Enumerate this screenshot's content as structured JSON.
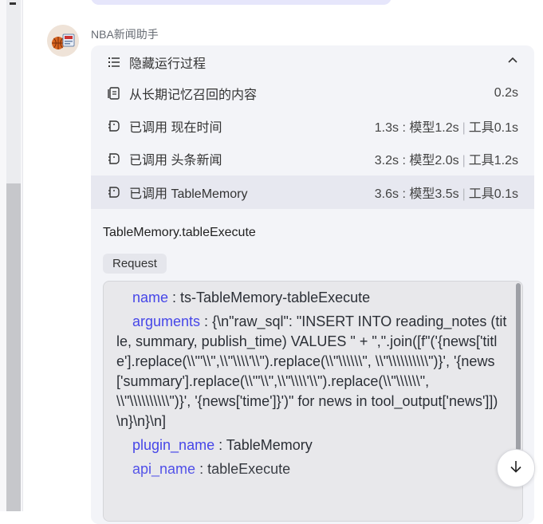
{
  "bot": {
    "name": "NBA新闻助手"
  },
  "process": {
    "toggle_label": "隐藏运行过程",
    "steps": [
      {
        "label": "从长期记忆召回的内容",
        "time": "0.2s"
      },
      {
        "label": "已调用 现在时间",
        "time": "1.3s : 模型1.2s",
        "tool": "工具0.1s"
      },
      {
        "label": "已调用 头条新闻",
        "time": "3.2s : 模型2.0s",
        "tool": "工具1.2s"
      },
      {
        "label": "已调用 TableMemory",
        "time": "3.6s : 模型3.5s",
        "tool": "工具0.1s"
      }
    ]
  },
  "detail": {
    "function": "TableMemory.tableExecute",
    "tab": "Request",
    "params": {
      "name_key": "name",
      "name_val": "ts-TableMemory-tableExecute",
      "arguments_key": "arguments",
      "arguments_val": "{\\n\"raw_sql\": \"INSERT INTO reading_notes (title, summary, publish_time) VALUES \" + \",\".join([f\"('{news['title'].replace(\\\\\"'\\\\\",\\\\\"\\\\\\\\'\\\\\").replace(\\\\\"\\\\\\\\\\\\\", \\\\\"\\\\\\\\\\\\\\\\\\\\\")}', '{news['summary'].replace(\\\\\"'\\\\\",\\\\\"\\\\\\\\'\\\\\").replace(\\\\\"\\\\\\\\\\\\\", \\\\\"\\\\\\\\\\\\\\\\\\\\\")}', '{news['time']}')\" for news in tool_output['news']])\\n}\\n}\\n]",
      "plugin_key": "plugin_name",
      "plugin_val": "TableMemory",
      "api_key": "api_name",
      "api_val": "tableExecute"
    }
  },
  "icons": {
    "list": "list-icon",
    "collapse": "chevron-up-icon",
    "memory": "memory-icon",
    "plugin": "plugin-icon",
    "scroll_down": "arrow-down-icon"
  }
}
